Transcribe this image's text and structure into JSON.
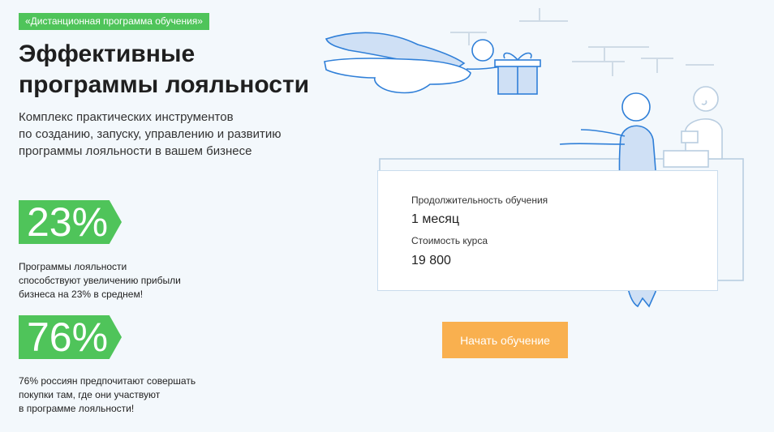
{
  "badge": "«Дистанционная программа обучения»",
  "hero": {
    "title_line1": "Эффективные",
    "title_line2": "программы лояльности",
    "subtitle_line1": "Комплекс практических инструментов",
    "subtitle_line2": "по созданию, запуску, управлению и развитию",
    "subtitle_line3": "программы лояльности в вашем бизнесе"
  },
  "stats": [
    {
      "value": "23%",
      "text_line1": "Программы лояльности",
      "text_line2": "способствуют увеличению прибыли",
      "text_line3": "бизнеса на 23% в среднем!"
    },
    {
      "value": "76%",
      "text_line1": "76% россиян предпочитают совершать",
      "text_line2": "покупки там, где они участвуют",
      "text_line3": "в программе лояльности!"
    }
  ],
  "course": {
    "duration_label": "Продолжительность обучения",
    "duration_value": "1 месяц",
    "price_label": "Стоимость курса",
    "price_value": "19 800"
  },
  "cta_label": "Начать обучение",
  "colors": {
    "accent_green": "#4fc45a",
    "cta_orange": "#f9b04f",
    "line_blue": "#2f7fd8",
    "fill_blue": "#cfe0f5"
  }
}
